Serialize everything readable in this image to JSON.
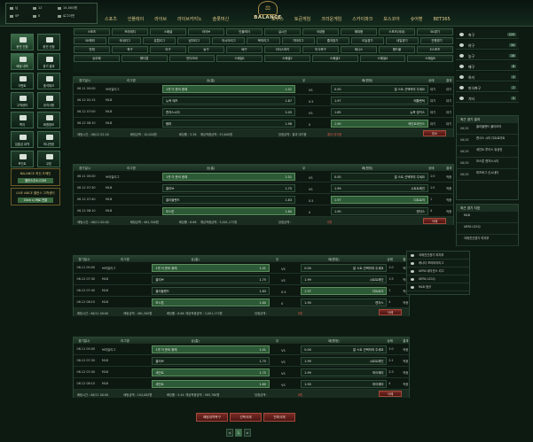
{
  "user": {
    "name": "님",
    "level": "12",
    "cash_label": "14,000원",
    "point_label": "0P",
    "msg_label": "0",
    "logout": "로그아웃",
    "coupon": "0",
    "mypage": "마이"
  },
  "logo": {
    "text": "BALANCE"
  },
  "nav": [
    "스포츠",
    "인플레이",
    "라이브",
    "라이브카지노",
    "슬롯머신",
    "로투스",
    "토큰게임",
    "크라운게임",
    "스카이파크",
    "보스코어",
    "슈어맨",
    "BET365"
  ],
  "left_buttons": [
    {
      "label": "충전 신청",
      "active": true
    },
    {
      "label": "환전 신청",
      "active": false
    },
    {
      "label": "배팅 내역",
      "active": true
    },
    {
      "label": "경기 결과",
      "active": false
    },
    {
      "label": "이벤트",
      "active": false
    },
    {
      "label": "출석체크",
      "active": false
    },
    {
      "label": "고객센터",
      "active": false
    },
    {
      "label": "공지사항",
      "active": false
    },
    {
      "label": "쪽지",
      "active": false
    },
    {
      "label": "회원정보",
      "active": false
    },
    {
      "label": "입출금 내역",
      "active": false
    },
    {
      "label": "머니전환",
      "active": false
    },
    {
      "label": "포인트",
      "active": false
    },
    {
      "label": "쿠폰",
      "active": false
    }
  ],
  "promos": [
    {
      "title": "BALANCE 최신 도메인",
      "cta": "밸런스주소.COM"
    },
    {
      "title": "LIVE ANCE 밸런스 고객센터",
      "cta": "Click 시 바로 연결"
    }
  ],
  "filters": [
    [
      "스포츠",
      "프리매치",
      "스페셜",
      "라이브",
      "인플레이",
      "실시간",
      "국내형",
      "해외형",
      "스포츠(국내)",
      "SK경기"
    ],
    [
      "SK해외",
      "국내리그",
      "유럽리그",
      "남미리그",
      "아시아리그",
      "북미리그",
      "기타리그",
      "즐겨찾기",
      "오늘경기",
      "내일경기",
      "진행경기"
    ],
    [
      "전체",
      "축구",
      "야구",
      "농구",
      "배구",
      "아이스하키",
      "미식축구",
      "테니스",
      "핸드볼",
      "E스포츠"
    ],
    [
      "승무패",
      "핸디캡",
      "언더오버",
      "스페셜1",
      "스페셜2",
      "스페셜3",
      "스페셜4",
      "스페셜5"
    ]
  ],
  "table_headers": {
    "date": "경기일시",
    "league": "리그명",
    "home": "승(홈)",
    "draw": "무",
    "away": "패(원정)",
    "status": "상태",
    "result": "결과"
  },
  "slips": [
    {
      "rows": [
        {
          "date": "06.11 00:00",
          "league": "브라질리그",
          "home": "1셋 이 준비 중예",
          "ho": "1.01",
          "d": "VS",
          "a": "0.00",
          "away": "잘 스트 선택하여 주세요",
          "s": "대기",
          "r": "대기",
          "sel": "home"
        },
        {
          "date": "06.12 02:15",
          "league": "MLB",
          "home": "뉴욕 메츠",
          "ho": "1.87",
          "d": "0.5",
          "a": "1.97",
          "away": "애틀랜틱",
          "s": "대기",
          "r": "대기",
          "sel": "none"
        },
        {
          "date": "06.12 07:00",
          "league": "MLB",
          "home": "캔자스시티",
          "ho": "2.05",
          "d": "VS",
          "a": "1.85",
          "away": "뉴욕 양키스",
          "s": "대기",
          "r": "대기",
          "sel": "none"
        },
        {
          "date": "06.12 08:10",
          "league": "MLB",
          "home": "탬파",
          "ho": "1.98",
          "d": "0",
          "a": "1.90",
          "away": "메인트라인스",
          "s": "대기",
          "r": "대기",
          "sel": "away"
        }
      ],
      "footer": {
        "bettime": "배팅시간 : 06/12 02:20",
        "amount": "배팅금액 : 10,000원",
        "odds": "배당률 : 5.36",
        "expect": "예상적중금액 : 53,600원",
        "result": "당첨금액 : 결과 대기중",
        "status": "결과 대기중"
      },
      "btn": "취소"
    },
    {
      "rows": [
        {
          "date": "06.11 00:00",
          "league": "브라질리그",
          "home": "1셋 이 준비 중예",
          "ho": "1.01",
          "d": "VS",
          "a": "0.00",
          "away": "잘 스트 선택하여 주세요",
          "s": "1:0",
          "r": "적중",
          "sel": "home"
        },
        {
          "date": "06.12 07:30",
          "league": "MLB",
          "home": "클리브",
          "ho": "1.75",
          "d": "VS",
          "a": "1.99",
          "away": "시트트레인",
          "s": "1:5",
          "r": "적중",
          "sel": "none"
        },
        {
          "date": "06.12 07:40",
          "league": "MLB",
          "home": "클리블랜드",
          "ho": "1.83",
          "d": "0.5",
          "a": "1.97",
          "away": "디트로이",
          "s": "1",
          "r": "적중",
          "sel": "away"
        },
        {
          "date": "06.12 08:10",
          "league": "MLB",
          "home": "보스톤",
          "ho": "1.80",
          "d": "0",
          "a": "1.90",
          "away": "캔자스",
          "s": "4",
          "r": "적중",
          "sel": "home"
        }
      ],
      "footer": {
        "bettime": "배팅시간 : 06/11 00:00",
        "amount": "배팅금액 : 461,300원",
        "odds": "배당률 : 6.66",
        "expect": "예상적중금액 : 3,001,172원",
        "result": "당첨금액 : ",
        "status": "0원"
      },
      "btn": "삭제"
    },
    {
      "rows": [
        {
          "date": "06.11 00:00",
          "league": "브라질리그",
          "home": "1셋 이 준비 중예",
          "ho": "1.01",
          "d": "VS",
          "a": "0.00",
          "away": "잘 스트 선택하여 주세요",
          "s": "1:0",
          "r": "적중",
          "sel": "home"
        },
        {
          "date": "06.12 07:30",
          "league": "MLB",
          "home": "클리브",
          "ho": "1.75",
          "d": "VS",
          "a": "1.99",
          "away": "시트트레인",
          "s": "1:5",
          "r": "적중",
          "sel": "none"
        },
        {
          "date": "06.12 07:40",
          "league": "MLB",
          "home": "클리블랜드",
          "ho": "1.83",
          "d": "0.5",
          "a": "1.97",
          "away": "디트로이",
          "s": "1",
          "r": "적중",
          "sel": "away"
        },
        {
          "date": "06.12 08:10",
          "league": "MLB",
          "home": "보스톤",
          "ho": "1.80",
          "d": "0",
          "a": "1.90",
          "away": "캔자스",
          "s": "4",
          "r": "적중",
          "sel": "home"
        }
      ],
      "footer": {
        "bettime": "배팅시간 : 06/11 00:00",
        "amount": "배팅금액 : 461,300원",
        "odds": "배당률 : 6.66",
        "expect": "예상적중금액 : 3,001,172원",
        "result": "당첨금액 : ",
        "status": "0원"
      },
      "btn": "삭제"
    },
    {
      "rows": [
        {
          "date": "06.11 00:00",
          "league": "브라질리그",
          "home": "1셋 이 준비 중예",
          "ho": "1.01",
          "d": "VS",
          "a": "0.00",
          "away": "잘 스트 선택하여 주세요",
          "s": "1:0",
          "r": "적중",
          "sel": "home"
        },
        {
          "date": "06.12 07:30",
          "league": "MLB",
          "home": "클리브",
          "ho": "1.75",
          "d": "VS",
          "a": "1.99",
          "away": "시트트레인",
          "s": "2:1",
          "r": "적중",
          "sel": "none"
        },
        {
          "date": "06.12 07:40",
          "league": "MLB",
          "home": "세인트",
          "ho": "1.75",
          "d": "VS",
          "a": "1.99",
          "away": "마이애미",
          "s": "2:3",
          "r": "적중",
          "sel": "home"
        },
        {
          "date": "06.12 08:10",
          "league": "MLB",
          "home": "세인트",
          "ho": "1.80",
          "d": "VS",
          "a": "1.90",
          "away": "마이애미",
          "s": "4",
          "r": "적중",
          "sel": "home"
        }
      ],
      "footer": {
        "bettime": "배팅시간 : 06/11 00:00",
        "amount": "배팅금액 : 104,000원",
        "odds": "배당률 : 5.44",
        "expect": "예상적중금액 : 565,760원",
        "result": "당첨금액 : ",
        "status": "0원"
      },
      "btn": "삭제"
    }
  ],
  "bottom_buttons": [
    "배팅내역복구",
    "선택삭제",
    "전체삭제"
  ],
  "pager": [
    "<",
    "1",
    ">"
  ],
  "sports": [
    {
      "name": "축구",
      "count": "120"
    },
    {
      "name": "야구",
      "count": "34"
    },
    {
      "name": "농구",
      "count": "18"
    },
    {
      "name": "배구",
      "count": "8"
    },
    {
      "name": "하키",
      "count": "4"
    },
    {
      "name": "미식축구",
      "count": "2"
    },
    {
      "name": "기타",
      "count": "5"
    }
  ],
  "recent_results": {
    "title": "최근 경기 결과",
    "items": [
      {
        "date": "06/18",
        "name": "클리블랜드 볼티모어"
      },
      {
        "date": "06/18",
        "name": "캔사스 시티 디트로이트"
      },
      {
        "date": "06/18",
        "name": "세인트 루이스 워싱턴"
      },
      {
        "date": "06/18",
        "name": "보스톤 캔자스시티"
      },
      {
        "date": "06/18",
        "name": "피츠버그 신시내티"
      }
    ]
  },
  "recent_bets": {
    "title": "최근 경기 지표",
    "items": [
      {
        "name": "MLB"
      },
      {
        "name": "UEFA U21Q"
      },
      {
        "name": "국제친선경기 여자부"
      }
    ]
  },
  "popup_items": [
    "국제친선경기 여자부",
    "캐나다 프리미어리그",
    "UEFA 네이션스 리그",
    "UEFA U21Q",
    "MLB 정규"
  ]
}
